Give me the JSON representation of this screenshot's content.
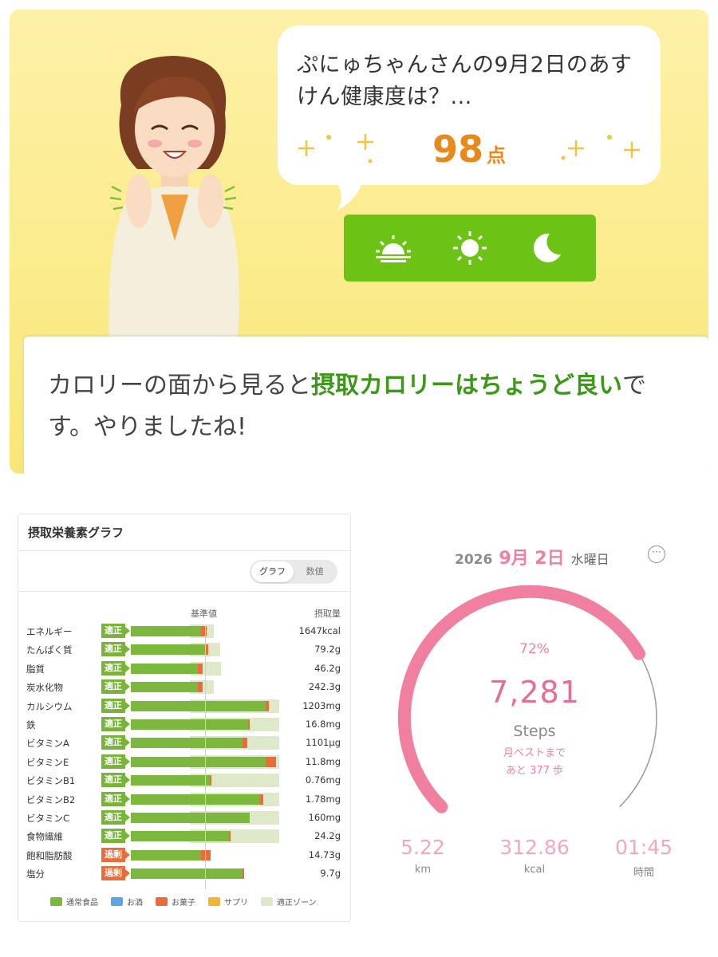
{
  "health": {
    "question": "ぷにゅちゃんさんの9月2日のあすけん健康度は？...",
    "score": "98",
    "score_unit": "点",
    "time_toggle": [
      "sunrise-icon",
      "sun-icon",
      "moon-icon"
    ],
    "message_before": "カロリーの面から見ると",
    "message_highlight": "摂取カロリーはちょうど良い",
    "message_after": "です。やりましたね!",
    "colors": {
      "score": "#e8891c",
      "toggle": "#6cc316",
      "highlight": "#3a9a16"
    }
  },
  "nutrients": {
    "title": "摂取栄養素グラフ",
    "switch": {
      "graph": "グラフ",
      "numeric": "数値",
      "active": "graph"
    },
    "col_reference": "基準値",
    "col_intake": "摂取量",
    "rows": [
      {
        "name": "エネルギー",
        "status": "適正",
        "level": "ok",
        "normal": 0.95,
        "snack": 0.07,
        "zone_min": 0.8,
        "zone_max": 1.12,
        "value": "1647kcal"
      },
      {
        "name": "たんぱく質",
        "status": "適正",
        "level": "ok",
        "normal": 1.0,
        "snack": 0.04,
        "zone_min": 0.8,
        "zone_max": 1.2,
        "value": "79.2g"
      },
      {
        "name": "脂質",
        "status": "適正",
        "level": "ok",
        "normal": 0.9,
        "snack": 0.07,
        "zone_min": 0.8,
        "zone_max": 1.22,
        "value": "46.2g"
      },
      {
        "name": "炭水化物",
        "status": "適正",
        "level": "ok",
        "normal": 0.9,
        "snack": 0.07,
        "zone_min": 0.8,
        "zone_max": 1.12,
        "value": "242.3g"
      },
      {
        "name": "カルシウム",
        "status": "適正",
        "level": "ok",
        "normal": 1.82,
        "snack": 0.04,
        "zone_min": 0.8,
        "zone_max": 2.0,
        "value": "1203mg"
      },
      {
        "name": "鉄",
        "status": "適正",
        "level": "ok",
        "normal": 1.58,
        "snack": 0.02,
        "zone_min": 0.8,
        "zone_max": 2.0,
        "value": "16.8mg"
      },
      {
        "name": "ビタミンA",
        "status": "適正",
        "level": "ok",
        "normal": 1.5,
        "snack": 0.07,
        "zone_min": 0.8,
        "zone_max": 2.0,
        "value": "1101μg"
      },
      {
        "name": "ビタミンE",
        "status": "適正",
        "level": "ok",
        "normal": 1.82,
        "snack": 0.14,
        "zone_min": 0.8,
        "zone_max": 2.0,
        "value": "11.8mg"
      },
      {
        "name": "ビタミンB1",
        "status": "適正",
        "level": "ok",
        "normal": 1.06,
        "snack": 0.03,
        "zone_min": 0.8,
        "zone_max": 2.0,
        "value": "0.76mg"
      },
      {
        "name": "ビタミンB2",
        "status": "適正",
        "level": "ok",
        "normal": 1.74,
        "snack": 0.04,
        "zone_min": 0.8,
        "zone_max": 2.0,
        "value": "1.78mg"
      },
      {
        "name": "ビタミンC",
        "status": "適正",
        "level": "ok",
        "normal": 1.6,
        "snack": 0.0,
        "zone_min": 0.8,
        "zone_max": 2.0,
        "value": "160mg"
      },
      {
        "name": "食物繊維",
        "status": "適正",
        "level": "ok",
        "normal": 1.32,
        "snack": 0.02,
        "zone_min": 0.8,
        "zone_max": 2.0,
        "value": "24.2g"
      },
      {
        "name": "飽和脂肪酸",
        "status": "過剰",
        "level": "over",
        "normal": 0.95,
        "snack": 0.12,
        "zone_min": 0.0,
        "zone_max": 0.0,
        "value": "14.73g"
      },
      {
        "name": "塩分",
        "status": "過剰",
        "level": "over",
        "normal": 1.5,
        "snack": 0.02,
        "zone_min": 0.0,
        "zone_max": 0.0,
        "value": "9.7g"
      }
    ],
    "legend": [
      {
        "label": "通常食品",
        "color": "#7db83e"
      },
      {
        "label": "お酒",
        "color": "#5aa7e0"
      },
      {
        "label": "お菓子",
        "color": "#ec6b3a"
      },
      {
        "label": "サプリ",
        "color": "#f5b531"
      },
      {
        "label": "適正ゾーン",
        "color": "#dde9c9"
      }
    ]
  },
  "steps": {
    "year": "2026",
    "month_day": "9月 2日",
    "weekday": "水曜日",
    "more": "···",
    "percent": "72%",
    "progress": 0.72,
    "count": "7,281",
    "label": "Steps",
    "best_line1": "月ベストまで",
    "best_line2": "あと 377 歩",
    "distance": "5.22",
    "distance_unit": "km",
    "calories": "312.86",
    "calories_unit": "kcal",
    "duration": "01:45",
    "duration_unit": "時間",
    "colors": {
      "accent": "#f07fa0",
      "track": "#9a9a9a"
    }
  }
}
